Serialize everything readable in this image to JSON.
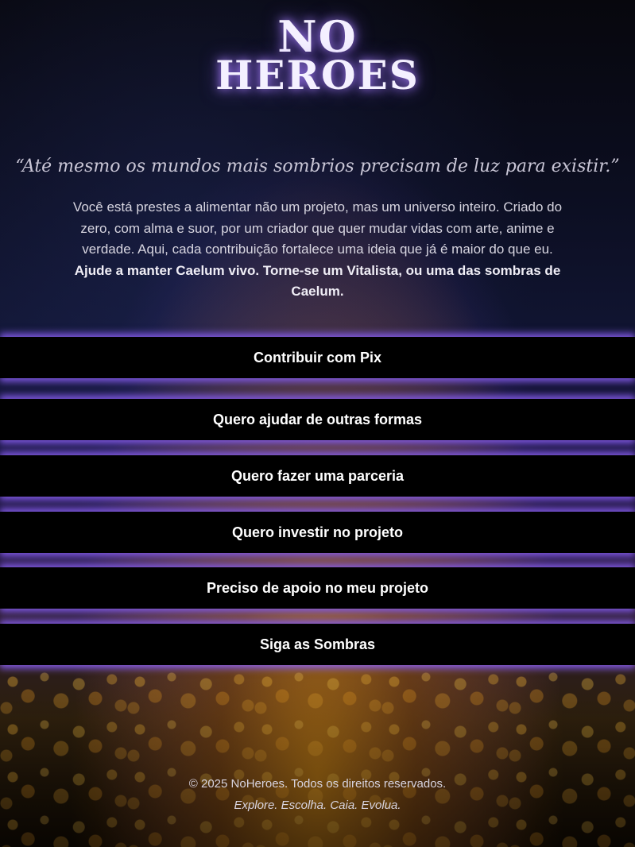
{
  "brand": {
    "logo_line1": "NO",
    "logo_line2": "HEROES"
  },
  "hero": {
    "quote": "“Até mesmo os mundos mais sombrios precisam de luz para existir.”",
    "body": "Você está prestes a alimentar não um projeto, mas um universo inteiro. Criado do zero, com alma e suor, por um criador que quer mudar vidas com arte, anime e verdade. Aqui, cada contribuição fortalece uma ideia que já é maior do que eu.",
    "cta": "Ajude a manter Caelum vivo. Torne-se um Vitalista, ou uma das sombras de Caelum."
  },
  "buttons": [
    {
      "label": "Contribuir com Pix"
    },
    {
      "label": "Quero ajudar de outras formas"
    },
    {
      "label": "Quero fazer uma parceria"
    },
    {
      "label": "Quero investir no projeto"
    },
    {
      "label": "Preciso de apoio no meu projeto"
    },
    {
      "label": "Siga as Sombras"
    }
  ],
  "footer": {
    "copyright": "© 2025 NoHeroes. Todos os direitos reservados.",
    "tagline": "Explore. Escolha. Caia. Evolua."
  },
  "colors": {
    "glow": "#8a5cf0",
    "button_bg": "#000000",
    "gold": "#d99a2a"
  }
}
